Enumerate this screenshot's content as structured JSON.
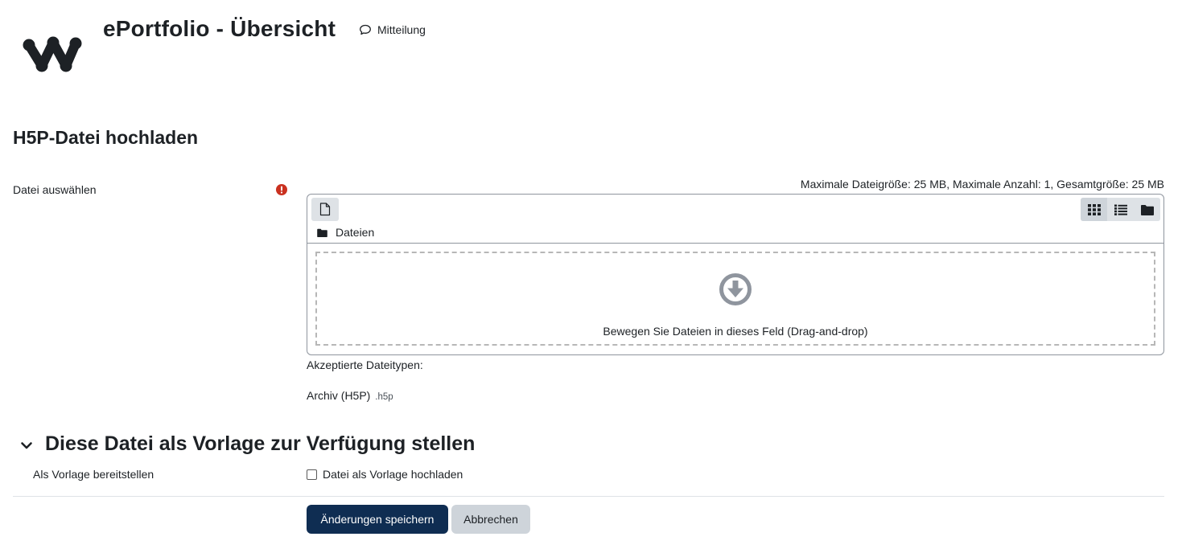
{
  "header": {
    "title": "ePortfolio - Übersicht",
    "message_label": "Mitteilung"
  },
  "form": {
    "heading": "H5P-Datei hochladen",
    "file_field_label": "Datei auswählen",
    "size_info": "Maximale Dateigröße: 25 MB, Maximale Anzahl: 1, Gesamtgröße: 25 MB",
    "filemanager": {
      "path_label": "Dateien",
      "drop_text": "Bewegen Sie Dateien in dieses Feld (Drag-and-drop)",
      "active_view": "icons"
    },
    "accepted_label": "Akzeptierte Dateitypen:",
    "accepted_type_name": "Archiv (H5P)",
    "accepted_type_ext": ".h5p"
  },
  "template_section": {
    "heading": "Diese Datei als Vorlage zur Verfügung stellen",
    "row_label": "Als Vorlage bereitstellen",
    "checkbox_label": "Datei als Vorlage hochladen",
    "checked": false
  },
  "buttons": {
    "save_label": "Änderungen speichern",
    "cancel_label": "Abbrechen"
  },
  "colors": {
    "primary": "#0f2d52",
    "required": "#ca3120",
    "secondary_button": "#ced4da"
  }
}
